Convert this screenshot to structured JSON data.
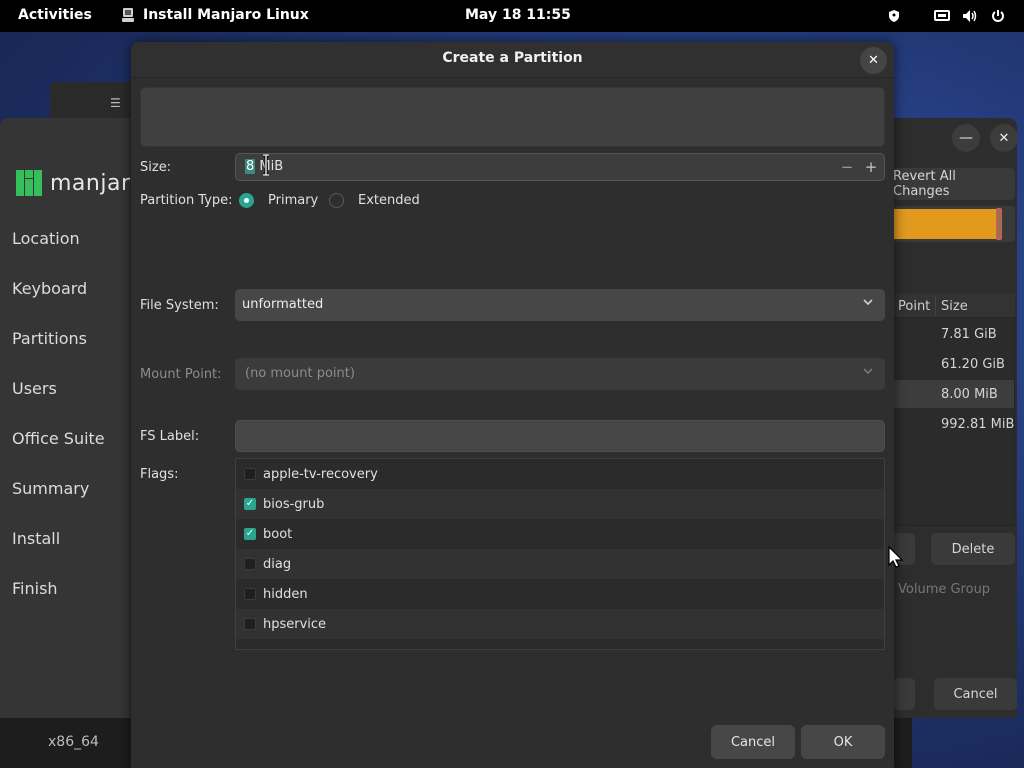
{
  "topbar": {
    "activities": "Activities",
    "app_title": "Install Manjaro Linux",
    "clock": "May 18  11:55",
    "icons": [
      "shield-icon",
      "network-icon",
      "volume-icon",
      "power-icon"
    ]
  },
  "installer": {
    "logo_text": "manjaro",
    "sidebar": [
      "Location",
      "Keyboard",
      "Partitions",
      "Users",
      "Office Suite",
      "Summary",
      "Install",
      "Finish"
    ],
    "footer_arch": "x86_64",
    "revert_label": "Revert All Changes",
    "table_headers": [
      "Point",
      "Size"
    ],
    "sizes": [
      "7.81 GiB",
      "61.20 GiB",
      "8.00 MiB",
      "992.81 MiB"
    ],
    "delete_label": "Delete",
    "volume_group_label": "Volume Group",
    "cancel_label": "Cancel"
  },
  "dialog": {
    "title": "Create a Partition",
    "size_label": "Size:",
    "size_value_selected": "8",
    "size_value_rest": " MiB",
    "partition_type_label": "Partition Type:",
    "primary_label": "Primary",
    "extended_label": "Extended",
    "file_system_label": "File System:",
    "file_system_value": "unformatted",
    "mount_point_label": "Mount Point:",
    "mount_point_value": "(no mount point)",
    "fs_label_label": "FS Label:",
    "fs_label_value": "",
    "flags_label": "Flags:",
    "flags": [
      {
        "name": "apple-tv-recovery",
        "checked": false
      },
      {
        "name": "bios-grub",
        "checked": true
      },
      {
        "name": "boot",
        "checked": true
      },
      {
        "name": "diag",
        "checked": false
      },
      {
        "name": "hidden",
        "checked": false
      },
      {
        "name": "hpservice",
        "checked": false
      }
    ],
    "cancel_label": "Cancel",
    "ok_label": "OK"
  },
  "colors": {
    "accent": "#2aa58f",
    "bar_fill": "#e29a1e",
    "manjaro_green": "#35bf5c"
  }
}
